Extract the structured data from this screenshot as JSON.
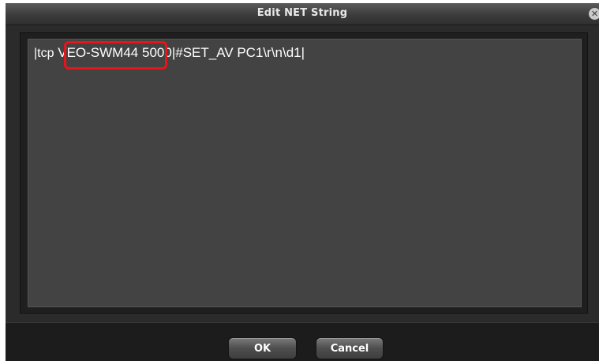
{
  "dialog": {
    "title": "Edit NET String",
    "close_icon": "close-icon"
  },
  "editor": {
    "segments": {
      "prefix": "|tcp",
      "host": "VEO-SWM44",
      "suffix": "5000|#SET_AV PC1\\r\\n\\d1|"
    },
    "highlight_color": "#e8141a"
  },
  "buttons": {
    "ok_label": "OK",
    "cancel_label": "Cancel"
  },
  "colors": {
    "dialog_bg": "#2b2b2b",
    "editor_bg": "#434343",
    "text": "#ffffff"
  }
}
